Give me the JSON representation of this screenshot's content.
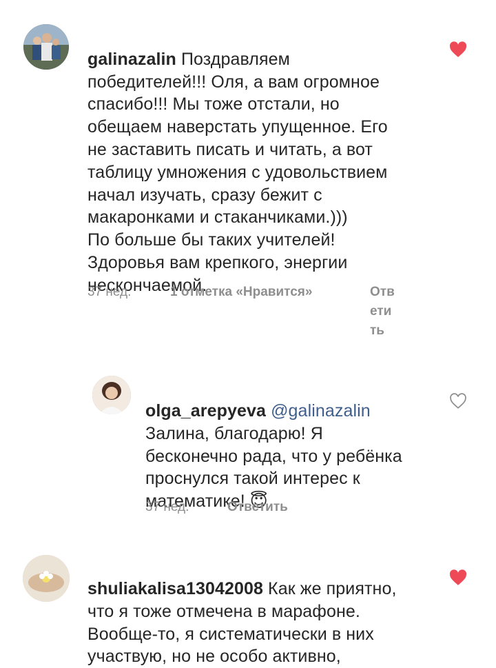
{
  "comments": [
    {
      "username": "galinazalin",
      "text": "Поздравляем\nпобедителей!!! Оля, а вам огромное\nспасибо!!! Мы тоже отстали, но\nобещаем наверстать упущенное. Его\nне заставить писать и читать, а вот\nтаблицу умножения с удовольствием\nначал изучать, сразу бежит с\nмакаронками и стаканчиками.)))\nПо больше бы таких учителей!\nЗдоровья вам крепкого,  энергии\nнескончаемой.",
      "time": "37 нед.",
      "likes": "1 отметка «Нравится»",
      "reply": "Отв\nети\nть",
      "liked": true
    },
    {
      "username": "olga_arepyeva",
      "mention": "@galinazalin",
      "text": "Залина, благодарю! Я\nбесконечно рада, что у ребёнка\nпроснулся такой интерес к\nматематике!",
      "emoji": "😇",
      "time": "37 нед.",
      "reply": "Ответить",
      "liked": false
    },
    {
      "username": "shuliakalisa13042008",
      "text": "Как же приятно,\nчто я тоже отмечена в марафоне.\nВообще-то, я систематически в них\nучаствую, но не особо активно,",
      "liked": true
    }
  ],
  "colors": {
    "liked_heart": "#ed4956",
    "muted": "#8e8e8e",
    "mention": "#3f5e8c"
  },
  "icons": {
    "heart_filled": "heart-filled-icon",
    "heart_outline": "heart-outline-icon"
  }
}
